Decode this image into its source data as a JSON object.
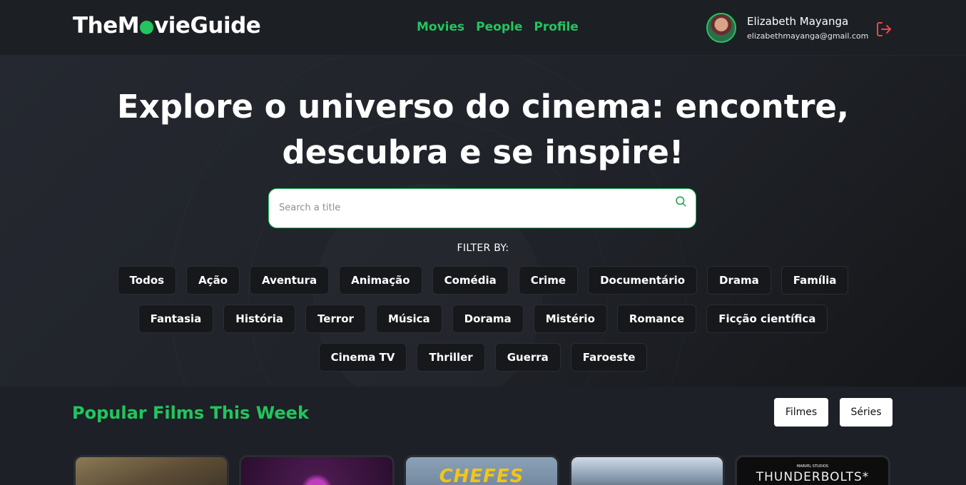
{
  "header": {
    "logo_part1": "TheM",
    "logo_part2": "vieGuide",
    "nav": [
      "Movies",
      "People",
      "Profile"
    ],
    "user_name": "Elizabeth Mayanga",
    "user_email": "elizabethmayanga@gmail.com"
  },
  "hero": {
    "title_line1": "Explore o universo do cinema: encontre,",
    "title_line2": "descubra e se inspire!",
    "search_placeholder": "Search a title",
    "filter_label": "FILTER BY:",
    "genre_rows": [
      [
        "Todos",
        "Ação",
        "Aventura",
        "Animação",
        "Comédia",
        "Crime",
        "Documentário",
        "Drama",
        "Família"
      ],
      [
        "Fantasia",
        "História",
        "Terror",
        "Música",
        "Dorama",
        "Mistério",
        "Romance",
        "Ficção científica"
      ],
      [
        "Cinema TV",
        "Thriller",
        "Guerra",
        "Faroeste"
      ]
    ]
  },
  "popular": {
    "title": "Popular Films This Week",
    "btn_movies": "Filmes",
    "btn_series": "Séries",
    "poster_texts": [
      "",
      "",
      "CHEFES",
      "",
      "THUNDERBOLTS*"
    ],
    "poster_brand": "MARVEL STUDIOS"
  },
  "colors": {
    "accent": "#22c55e",
    "logout": "#ef4444"
  }
}
